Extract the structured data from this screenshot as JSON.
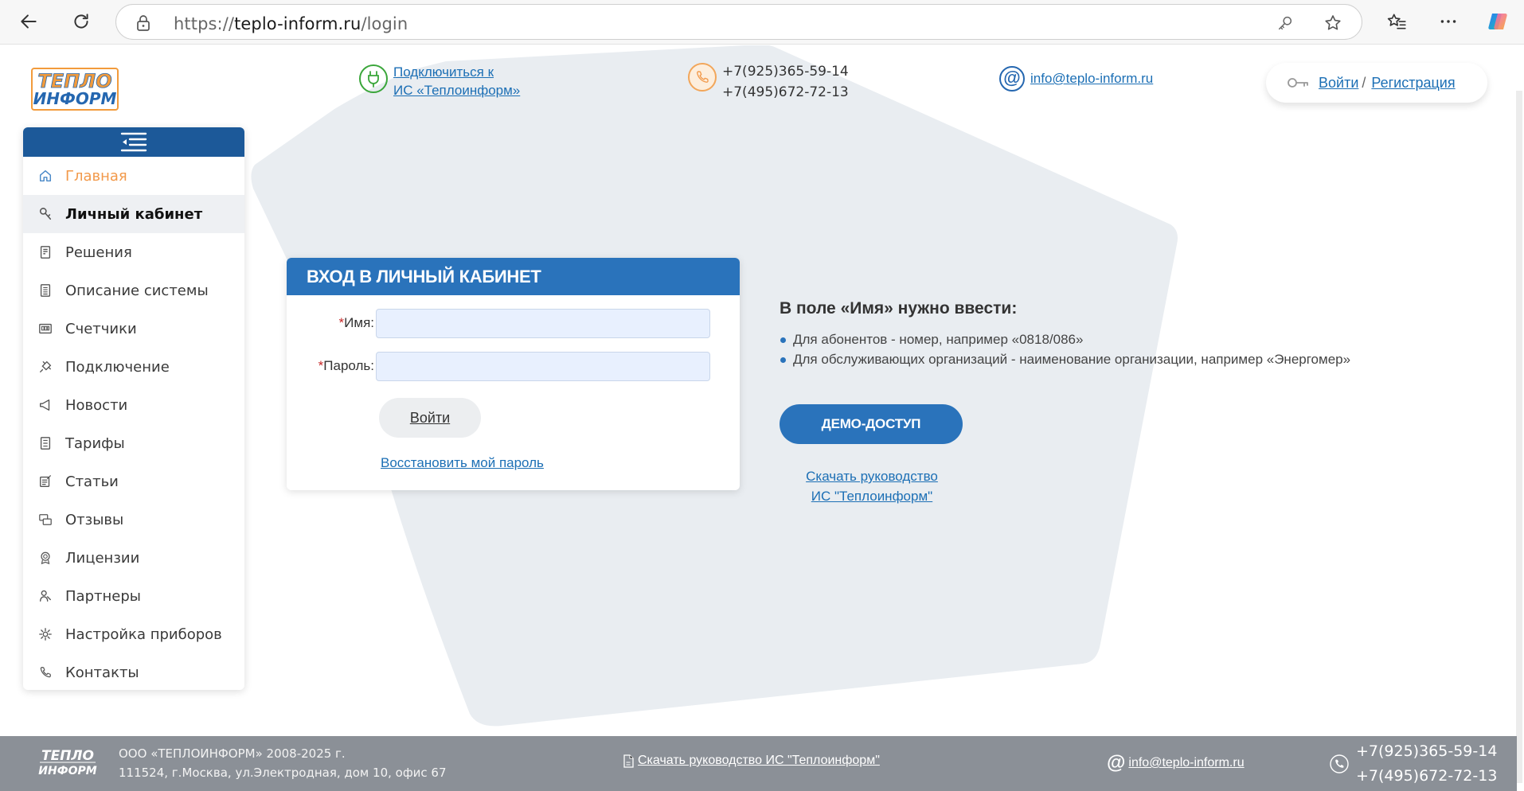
{
  "browser": {
    "url_prefix": "https://",
    "url_domain": "teplo-inform.ru",
    "url_path": "/login"
  },
  "header": {
    "logo_text_top": "ТЕПЛО",
    "logo_text_bottom": "ИНФОРМ",
    "connect_line1": "Подключиться к",
    "connect_line2": "ИС «Теплоинформ»",
    "phone1": "+7(925)365-59-14",
    "phone2": "+7(495)672-72-13",
    "email": "info@teplo-inform.ru",
    "login_label": "Войти",
    "login_sep": "/",
    "register_label": "Регистрация"
  },
  "sidebar": {
    "items": [
      {
        "label": "Главная",
        "icon": "home-icon"
      },
      {
        "label": "Личный кабинет",
        "icon": "key-icon"
      },
      {
        "label": "Решения",
        "icon": "solutions-icon"
      },
      {
        "label": "Описание системы",
        "icon": "document-icon"
      },
      {
        "label": "Счетчики",
        "icon": "meter-icon"
      },
      {
        "label": "Подключение",
        "icon": "plug-icon"
      },
      {
        "label": "Новости",
        "icon": "megaphone-icon"
      },
      {
        "label": "Тарифы",
        "icon": "tariff-icon"
      },
      {
        "label": "Статьи",
        "icon": "article-icon"
      },
      {
        "label": "Отзывы",
        "icon": "reviews-icon"
      },
      {
        "label": "Лицензии",
        "icon": "license-icon"
      },
      {
        "label": "Партнеры",
        "icon": "partners-icon"
      },
      {
        "label": "Настройка приборов",
        "icon": "gear-icon"
      },
      {
        "label": "Контакты",
        "icon": "phone-icon"
      }
    ]
  },
  "login_form": {
    "title": "ВХОД В ЛИЧНЫЙ КАБИНЕТ",
    "required_mark": "*",
    "name_label": "Имя:",
    "name_value": "",
    "password_label": "Пароль:",
    "password_value": "",
    "submit_label": "Войти",
    "restore_label": "Восстановить мой пароль"
  },
  "info": {
    "title": "В поле «Имя» нужно ввести:",
    "items": [
      "Для абонентов - номер, например «0818/086»",
      "Для обслуживающих организаций - наименование организации, например «Энергомер»"
    ],
    "demo_label": "ДЕМО-ДОСТУП",
    "guide_line1": "Скачать руководство",
    "guide_line2": "ИС \"Теплоинформ\""
  },
  "footer": {
    "company_line1": "ООО «ТЕПЛОИНФОРМ» 2008-2025 г.",
    "company_line2": "111524, г.Москва, ул.Электродная, дом 10, офис 67",
    "guide": "Скачать руководство ИС \"Теплоинформ\"",
    "email": "info@teplo-inform.ru",
    "phone1": "+7(925)365-59-14",
    "phone2": "+7(495)672-72-13"
  },
  "colors": {
    "brand_blue": "#2a73bb",
    "sidebar_header": "#1c5999",
    "accent_orange": "#f2994a",
    "footer_bg": "#8b9097",
    "background_shape": "#e9edf1"
  }
}
